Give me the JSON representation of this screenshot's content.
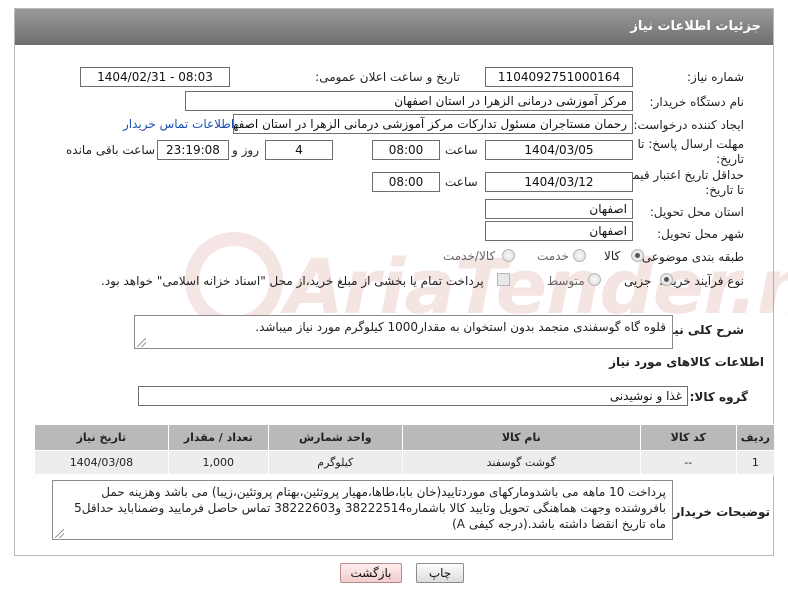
{
  "header": {
    "title": "جزئیات اطلاعات نیاز"
  },
  "watermark": {
    "text": "AriaTender.net"
  },
  "form": {
    "need_number": {
      "label": "شماره نیاز:",
      "value": "1104092751000164"
    },
    "announce_datetime": {
      "label": "تاریخ و ساعت اعلان عمومی:",
      "value": "1404/02/31 - 08:03"
    },
    "buyer_org": {
      "label": "نام دستگاه خریدار:",
      "value": "مرکز آموزشی درمانی الزهرا در استان اصفهان"
    },
    "requester": {
      "label": "ایجاد کننده درخواست:",
      "value": "رحمان مستاجران مسئول تدارکات مرکز آموزشی درمانی الزهرا در استان اصفهان",
      "contact_link": "اطلاعات تماس خریدار"
    },
    "reply_deadline": {
      "label_line1": "مهلت ارسال پاسخ: تا",
      "label_line2": "تاریخ:",
      "date": "1404/03/05",
      "time_label": "ساعت",
      "time": "08:00",
      "days": "4",
      "days_label": "روز و",
      "remaining": "23:19:08",
      "remaining_label": "ساعت باقی مانده"
    },
    "price_validity": {
      "label_line1": "حداقل تاریخ اعتبار قیمت:",
      "label_line2": "تا تاریخ:",
      "date": "1404/03/12",
      "time_label": "ساعت",
      "time": "08:00"
    },
    "delivery_province": {
      "label": "استان محل تحویل:",
      "value": "اصفهان"
    },
    "delivery_city": {
      "label": "شهر محل تحویل:",
      "value": "اصفهان"
    },
    "category": {
      "label": "طبقه بندی موضوعی:",
      "options": [
        "کالا",
        "خدمت",
        "کالا/خدمت"
      ],
      "selected": "کالا"
    },
    "purchase_process": {
      "label": "نوع فرآیند خرید :",
      "options": [
        "جزیی",
        "متوسط"
      ],
      "selected": "جزیی",
      "payment_note": "پرداخت تمام یا بخشی از مبلغ خرید،از محل \"اسناد خزانه اسلامی\" خواهد بود."
    }
  },
  "need_description": {
    "label": "شرح کلی نیاز:",
    "value": "قلوه گاه گوسفندی منجمد بدون استخوان به مقدار1000 کیلوگرم مورد نیاز میباشد."
  },
  "goods_info": {
    "title": "اطلاعات کالاهای مورد نیاز",
    "group_label": "گروه کالا:",
    "group_value": "غذا و نوشیدنی",
    "table": {
      "headers": [
        "ردیف",
        "کد کالا",
        "نام کالا",
        "واحد شمارش",
        "تعداد / مقدار",
        "تاریخ نیاز"
      ],
      "rows": [
        [
          "1",
          "--",
          "گوشت گوسفند",
          "کیلوگرم",
          "1,000",
          "1404/03/08"
        ]
      ]
    }
  },
  "buyer_notes": {
    "label": "توضیحات خریدار:",
    "value": "پرداخت 10 ماهه می باشدومارکهای موردتایید(خان بابا،طاها،مهیار پروتئین،بهتام پروتئین،زیبا) می باشد وهزینه حمل بافروشنده وجهت هماهنگی تحویل وتایید کالا باشماره38222514 و38222603 تماس حاصل فرمایید وضمناباید حداقل5 ماه تاریخ انقضا داشته باشد.(درجه کیفی A)"
  },
  "buttons": {
    "print": "چاپ",
    "back": "بازگشت"
  }
}
